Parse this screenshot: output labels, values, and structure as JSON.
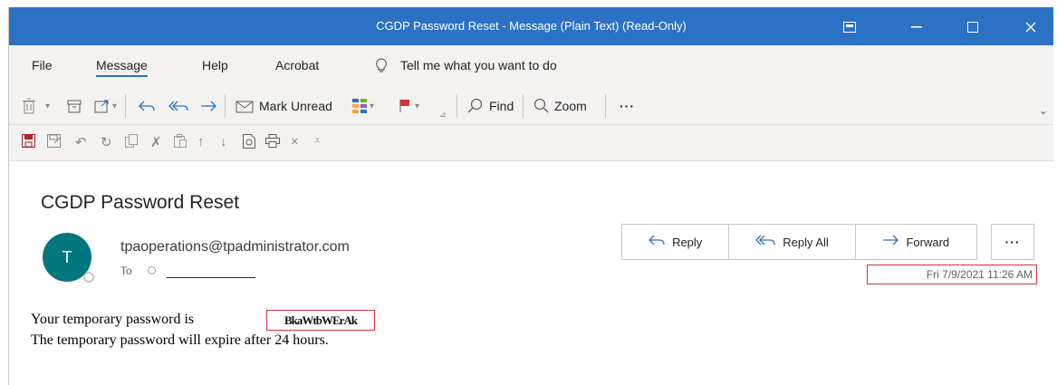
{
  "window": {
    "title": "CGDP Password Reset  -  Message (Plain Text) (Read-Only)",
    "buttons": [
      "restore-ribbon",
      "minimize",
      "maximize",
      "close"
    ]
  },
  "menu": {
    "items": [
      "File",
      "Message",
      "Help",
      "Acrobat"
    ],
    "active": "Message",
    "tell_me": "Tell me what you want to do"
  },
  "ribbon": {
    "mark_unread": "Mark Unread",
    "find": "Find",
    "zoom": "Zoom",
    "more": "···"
  },
  "message": {
    "subject": "CGDP Password Reset",
    "avatar_initial": "T",
    "sender": "tpaoperations@tpadministrator.com",
    "to_label": "To",
    "date": "Fri 7/9/2021 11:26 AM",
    "actions": {
      "reply": "Reply",
      "reply_all": "Reply All",
      "forward": "Forward",
      "more": "···"
    },
    "body_line1": "Your temporary password is",
    "password_redacted": "BkaWtbWErAk",
    "body_line2": "The temporary password will expire after 24 hours."
  },
  "colors": {
    "titlebar": "#2b72c4",
    "avatar": "#03787c",
    "highlight_border": "#d13438"
  }
}
